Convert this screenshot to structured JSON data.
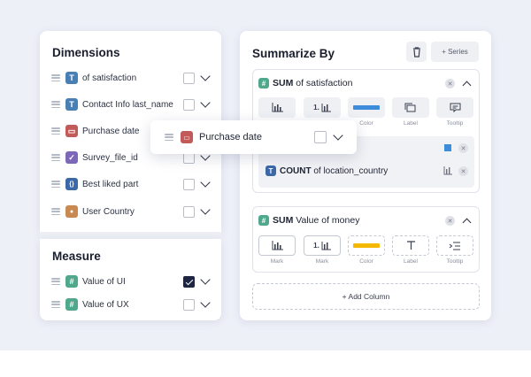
{
  "dimensions": {
    "title": "Dimensions",
    "items": [
      {
        "label": "of satisfaction",
        "icon": "T",
        "icon_name": "text-type-icon",
        "color": "#4a7fb5"
      },
      {
        "label": "Contact Info last_name",
        "icon": "T",
        "icon_name": "text-type-icon",
        "color": "#4a7fb5"
      },
      {
        "label": "Purchase date",
        "icon": "▭",
        "icon_name": "calendar-type-icon",
        "color": "#c25a5a"
      },
      {
        "label": "Survey_file_id",
        "icon": "✓",
        "icon_name": "checkbox-type-icon",
        "color": "#7d67b8"
      },
      {
        "label": "Best liked part",
        "icon": "{}",
        "icon_name": "object-type-icon",
        "color": "#3c68a8"
      },
      {
        "label": "User Country",
        "icon": "●",
        "icon_name": "location-type-icon",
        "color": "#c88a52"
      }
    ]
  },
  "measure": {
    "title": "Measure",
    "items": [
      {
        "label": "Value of UI",
        "icon": "#",
        "checked": true
      },
      {
        "label": "Value of UX",
        "icon": "#",
        "checked": false
      }
    ]
  },
  "summarize": {
    "title": "Summarize By",
    "series_button": "+ Series",
    "card1": {
      "agg": "SUM",
      "field": " of satisfaction",
      "labels": [
        "Color",
        "Label",
        "Tooltip"
      ],
      "mark_number": "1.",
      "sub_item": {
        "agg": "COUNT",
        "field": " of location_country"
      }
    },
    "card2": {
      "agg": "SUM",
      "field": " Value of money",
      "mark_number": "1.",
      "labels": [
        "Mark",
        "Mark",
        "Color",
        "Label",
        "Tooltip"
      ]
    },
    "add_column": "+ Add Column"
  },
  "drag_item": {
    "label": "Purchase date"
  },
  "colors": {
    "accent_blue": "#3d8bdb",
    "accent_yellow": "#f5b800",
    "dark": "#1d2542"
  }
}
